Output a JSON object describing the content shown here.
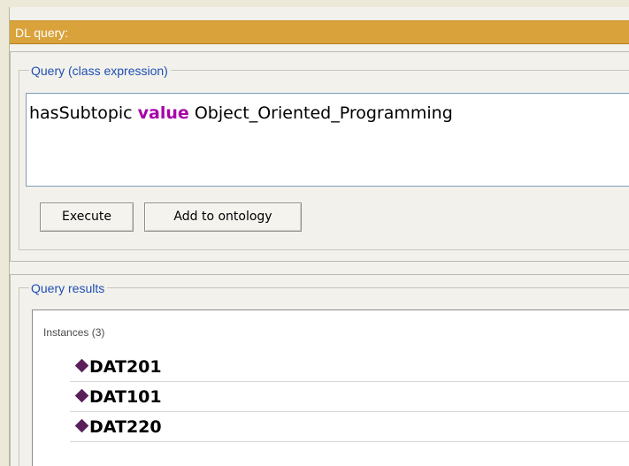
{
  "dl_query": {
    "title": "DL query:",
    "query_section": {
      "legend": "Query (class expression)",
      "expression_prefix": "hasSubtopic ",
      "expression_keyword": "value",
      "expression_suffix": " Object_Oriented_Programming",
      "buttons": {
        "execute": "Execute",
        "add_to_ontology": "Add to ontology"
      }
    },
    "results_section": {
      "legend": "Query results",
      "instances_header": "Instances (3)",
      "instances": [
        {
          "label": "DAT201",
          "icon": "individual-diamond-icon"
        },
        {
          "label": "DAT101",
          "icon": "individual-diamond-icon"
        },
        {
          "label": "DAT220",
          "icon": "individual-diamond-icon"
        }
      ]
    },
    "colors": {
      "titlebar": "#d9a23a",
      "legend_text": "#1f4fb4",
      "keyword": "#a800a8",
      "individual_icon": "#5a1f5a"
    }
  }
}
